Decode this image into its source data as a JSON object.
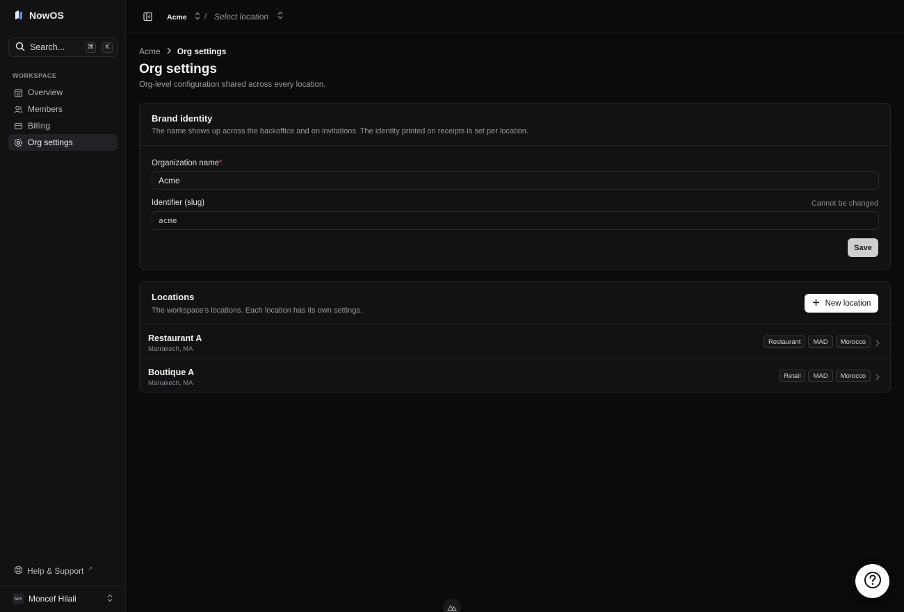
{
  "app": {
    "brand_name": "NowOS",
    "search_label": "Search...",
    "search_shortcut": [
      "⌘",
      "K"
    ]
  },
  "sidebar": {
    "section_label": "WORKSPACE",
    "items": [
      {
        "label": "Overview",
        "icon": "building-icon",
        "active": false
      },
      {
        "label": "Members",
        "icon": "users-icon",
        "active": false
      },
      {
        "label": "Billing",
        "icon": "wallet-icon",
        "active": false
      },
      {
        "label": "Org settings",
        "icon": "gear-icon",
        "active": true
      }
    ],
    "help_label": "Help & Support",
    "user": {
      "initials": "MH",
      "name": "Moncef Hilali"
    }
  },
  "topbar": {
    "org": "Acme",
    "separator": "/",
    "location_placeholder": "Select location"
  },
  "page": {
    "breadcrumb": {
      "parent": "Acme",
      "current": "Org settings"
    },
    "title": "Org settings",
    "subtitle": "Org-level configuration shared across every location."
  },
  "brand_card": {
    "title": "Brand identity",
    "description": "The name shows up across the backoffice and on invitations. The identity printed on receipts is set per location.",
    "org_name_label": "Organization name",
    "required_mark": "*",
    "org_name_value": "Acme",
    "slug_label": "Identifier (slug)",
    "slug_hint": "Cannot be changed",
    "slug_value": "acme",
    "save_label": "Save"
  },
  "locations_card": {
    "title": "Locations",
    "description": "The workspace's locations. Each location has its own settings.",
    "new_button_label": "New location",
    "rows": [
      {
        "name": "Restaurant A",
        "city": "Marrakech, MA",
        "badges": [
          "Restaurant",
          "MAD",
          "Morocco"
        ]
      },
      {
        "name": "Boutique A",
        "city": "Marrakech, MA",
        "badges": [
          "Retail",
          "MAD",
          "Morocco"
        ]
      }
    ]
  }
}
